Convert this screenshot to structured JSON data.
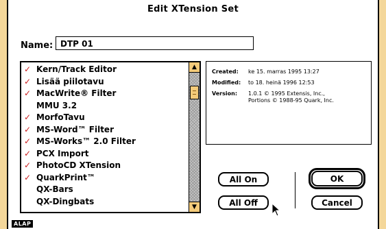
{
  "window": {
    "title": "Edit XTension Set"
  },
  "name_field": {
    "label": "Name:",
    "value": "DTP 01"
  },
  "xtensions": [
    {
      "label": "Kern/Track Editor",
      "checked": true
    },
    {
      "label": "Lisää piilotavu",
      "checked": true
    },
    {
      "label": "MacWrite® Filter",
      "checked": true
    },
    {
      "label": "MMU 3.2",
      "checked": false
    },
    {
      "label": "MorfoTavu",
      "checked": true
    },
    {
      "label": "MS-Word™ Filter",
      "checked": true
    },
    {
      "label": "MS-Works™ 2.0 Filter",
      "checked": true
    },
    {
      "label": "PCX Import",
      "checked": true
    },
    {
      "label": "PhotoCD XTension",
      "checked": true
    },
    {
      "label": "QuarkPrint™",
      "checked": true
    },
    {
      "label": "QX-Bars",
      "checked": false
    },
    {
      "label": "QX-Dingbats",
      "checked": false
    }
  ],
  "check_mark": "✓",
  "scroll_arrows": {
    "up": "▲",
    "down": "▼"
  },
  "info": {
    "created_label": "Created:",
    "created_value": "ke 15. marras 1995 13:27",
    "modified_label": "Modified:",
    "modified_value": "to 18. heinä 1996 12:53",
    "version_label": "Version:",
    "version_line1": "1.0.1 © 1995 Extensis, Inc.,",
    "version_line2": "Portions © 1988-95 Quark, Inc."
  },
  "buttons": {
    "all_on": "All On",
    "all_off": "All Off",
    "ok": "OK",
    "cancel": "Cancel"
  },
  "badge": "ALAP",
  "colors": {
    "background": "#f4d79a",
    "check_mark": "#cc2020",
    "scroll_accent": "#f4cb7a"
  },
  "icons": {
    "cursor": "arrow-cursor-icon"
  }
}
